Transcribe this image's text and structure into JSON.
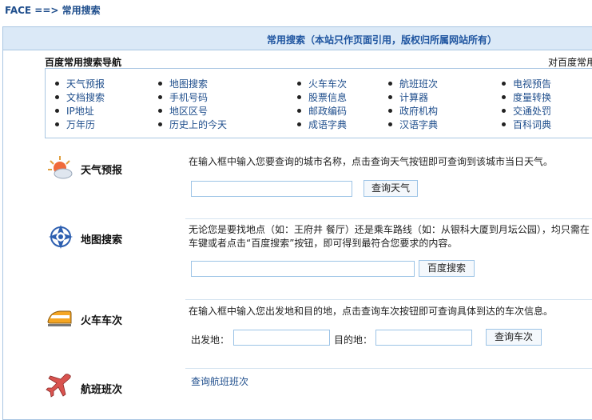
{
  "breadcrumb": "FACE ==> 常用搜索",
  "banner": "常用搜索（本站只作页面引用，版权归所属网站所有）",
  "nav": {
    "title": "百度常用搜索导航",
    "right_text": "对百度常用",
    "columns": [
      [
        "天气预报",
        "文档搜索",
        "IP地址",
        "万年历"
      ],
      [
        "地图搜索",
        "手机号码",
        "地区区号",
        "历史上的今天"
      ],
      [
        "火车车次",
        "股票信息",
        "邮政编码",
        "成语字典"
      ],
      [
        "航班班次",
        "计算器",
        "政府机构",
        "汉语字典"
      ],
      [
        "电视预告",
        "度量转换",
        "交通处罚",
        "百科词典"
      ]
    ]
  },
  "weather": {
    "title": "天气预报",
    "icon": "weather-icon",
    "desc": "在输入框中输入您要查询的城市名称，点击查询天气按钮即可查询到该城市当日天气。",
    "input_value": "",
    "button": "查询天气"
  },
  "map": {
    "title": "地图搜索",
    "icon": "map-icon",
    "desc_line1": "无论您是要找地点（如：王府井 餐厅）还是乘车路线（如：从银科大厦到月坛公园），均只需在",
    "desc_line2": "车键或者点击“百度搜索”按钮，即可得到最符合您要求的内容。",
    "input_value": "",
    "button": "百度搜索"
  },
  "train": {
    "title": "火车车次",
    "icon": "train-icon",
    "desc": "在输入框中输入您出发地和目的地，点击查询车次按钮即可查询具体到达的车次信息。",
    "from_label": "出发地：",
    "to_label": "目的地：",
    "from_value": "",
    "to_value": "",
    "button": "查询车次"
  },
  "flight": {
    "title": "航班班次",
    "icon": "airplane-icon",
    "link": "查询航班班次"
  },
  "colors": {
    "accent": "#1f4e8c",
    "banner_bg": "#dbe9f7",
    "border": "#a9c6e2"
  }
}
